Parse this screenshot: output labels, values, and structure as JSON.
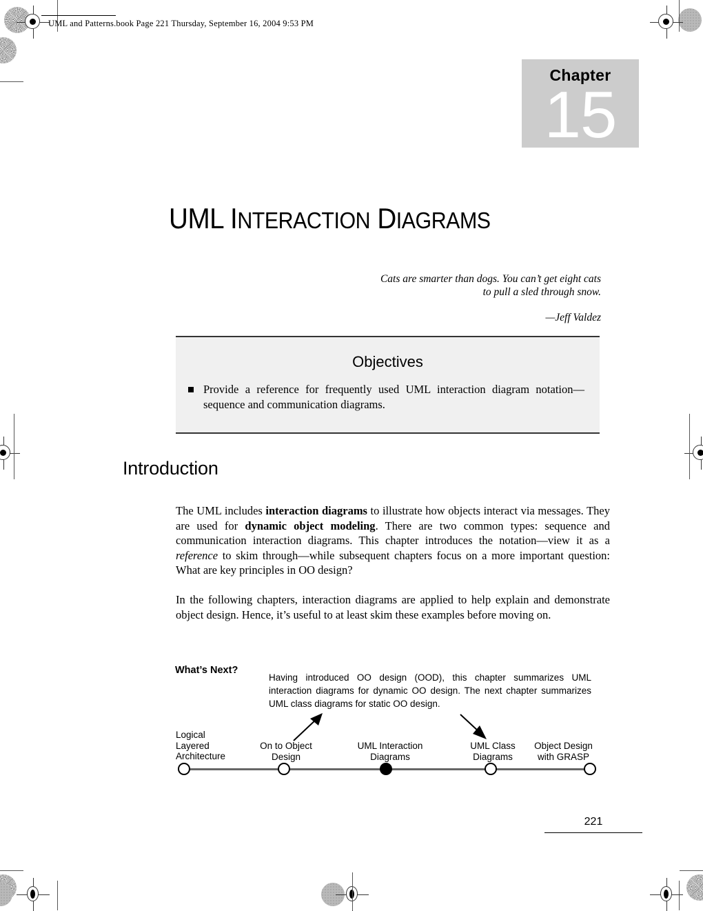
{
  "printer_header": {
    "text": "UML and Patterns.book  Page 221  Thursday, September 16, 2004  9:53 PM"
  },
  "chapter_badge": {
    "label": "Chapter",
    "number": "15",
    "bg_color": "#cccccc",
    "number_color": "#ffffff"
  },
  "chapter_title": {
    "part1_cap": "UML I",
    "part1_small": "NTERACTION",
    "part2_cap": " D",
    "part2_small": "IAGRAMS"
  },
  "epigraph": {
    "quote": "Cats are smarter than dogs. You can’t get eight cats to pull a sled through snow.",
    "attribution": "—Jeff Valdez"
  },
  "objectives": {
    "title": "Objectives",
    "items": [
      "Provide a reference for frequently used UML interaction diagram notation—sequence and communication diagrams."
    ],
    "bg_color": "#f0f0f0"
  },
  "introduction": {
    "heading": "Introduction",
    "paragraph1": {
      "run1": "The UML includes ",
      "bold1": "interaction diagrams",
      "run2": " to illustrate how objects interact via messages. They are used for ",
      "bold2": "dynamic object modeling",
      "run3": ". There are two common types: sequence and communication interaction diagrams. This chapter introduces the notation—view it as a ",
      "italic1": "reference",
      "run4": " to skim through—while subsequent chapters focus on a more important question: What are key principles in OO design?"
    },
    "paragraph2": "In the following chapters, interaction diagrams are applied to help explain and demonstrate object design. Hence, it’s useful to at least skim these examples before moving on."
  },
  "whats_next": {
    "label": "What’s Next?",
    "text": "Having introduced OO design (OOD), this chapter summarizes UML interaction diagrams for dynamic OO design. The next chapter summarizes UML class diagrams for static OO design."
  },
  "roadmap": {
    "nodes": [
      {
        "label": "Logical\nLayered\nArchitecture",
        "current": false
      },
      {
        "label": "On to Object\nDesign",
        "current": false
      },
      {
        "label": "UML Interaction\nDiagrams",
        "current": true
      },
      {
        "label": "UML Class\nDiagrams",
        "current": false
      },
      {
        "label": "Object Design\nwith GRASP",
        "current": false
      }
    ],
    "arrows": [
      {
        "direction": "up-right"
      },
      {
        "direction": "down-right"
      }
    ]
  },
  "footer": {
    "page_number": "221"
  }
}
